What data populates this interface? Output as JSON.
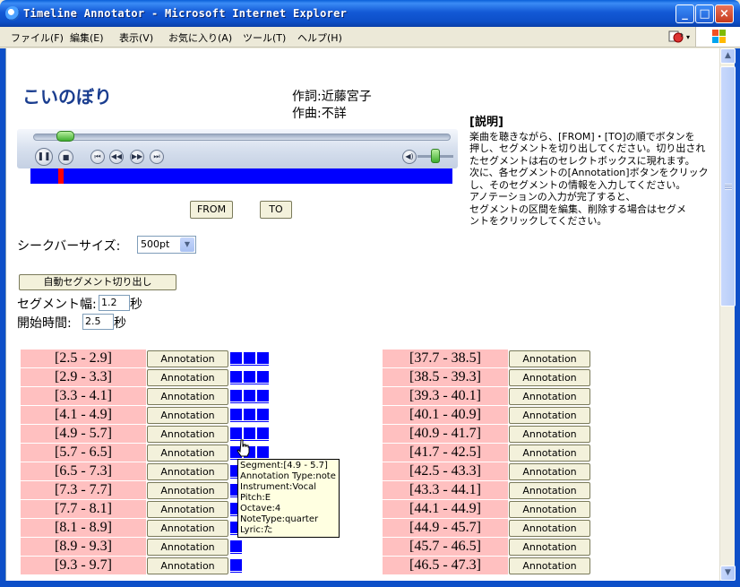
{
  "window": {
    "title": "Timeline Annotator - Microsoft Internet Explorer",
    "min_label": "_",
    "max_label": "□",
    "close_label": "×"
  },
  "menu": [
    "ファイル(F)",
    "編集(E)",
    "表示(V)",
    "お気に入り(A)",
    "ツール(T)",
    "ヘルプ(H)"
  ],
  "page": {
    "title": "こいのぼり",
    "lyricist": "作詞:近藤宮子",
    "composer": "作曲:不詳"
  },
  "player": {
    "seek_progress": 0.11,
    "marker_position_fraction": 0.065
  },
  "buttons": {
    "from": "FROM",
    "to": "TO",
    "auto_segment": "自動セグメント切り出し"
  },
  "explain": {
    "heading": "[説明]",
    "lines": [
      "楽曲を聴きながら、[FROM]・[TO]の順でボタンを",
      "押し、セグメントを切り出してください。切り出され",
      "たセグメントは右のセレクトボックスに現れます。",
      "次に、各セグメントの[Annotation]ボタンをクリック",
      "し、そのセグメントの情報を入力してください。",
      "アノテーションの入力が完了すると、",
      "セグメントの区間を編集、削除する場合はセグメ",
      "ントをクリックしてください。"
    ]
  },
  "controls": {
    "seekbar_size_label": "シークバーサイズ:",
    "seekbar_size_value": "500pt",
    "segment_width_label": "セグメント幅:",
    "segment_width_value": "1.2",
    "segment_width_unit": "秒",
    "start_time_label": "開始時間:",
    "start_time_value": "2.5",
    "start_time_unit": "秒"
  },
  "annotation_label": "Annotation",
  "segments_left": [
    {
      "range": "[2.5 - 2.9]",
      "squares": 3
    },
    {
      "range": "[2.9 - 3.3]",
      "squares": 3
    },
    {
      "range": "[3.3 - 4.1]",
      "squares": 3
    },
    {
      "range": "[4.1 - 4.9]",
      "squares": 3
    },
    {
      "range": "[4.9 - 5.7]",
      "squares": 3
    },
    {
      "range": "[5.7 - 6.5]",
      "squares": 3
    },
    {
      "range": "[6.5 - 7.3]",
      "squares": 1
    },
    {
      "range": "[7.3 - 7.7]",
      "squares": 1
    },
    {
      "range": "[7.7 - 8.1]",
      "squares": 1
    },
    {
      "range": "[8.1 - 8.9]",
      "squares": 1
    },
    {
      "range": "[8.9 - 9.3]",
      "squares": 1
    },
    {
      "range": "[9.3 - 9.7]",
      "squares": 1
    }
  ],
  "segments_right": [
    {
      "range": "[37.7 - 38.5]"
    },
    {
      "range": "[38.5 - 39.3]"
    },
    {
      "range": "[39.3 - 40.1]"
    },
    {
      "range": "[40.1 - 40.9]"
    },
    {
      "range": "[40.9 - 41.7]"
    },
    {
      "range": "[41.7 - 42.5]"
    },
    {
      "range": "[42.5 - 43.3]"
    },
    {
      "range": "[43.3 - 44.1]"
    },
    {
      "range": "[44.1 - 44.9]"
    },
    {
      "range": "[44.9 - 45.7]"
    },
    {
      "range": "[45.7 - 46.5]"
    },
    {
      "range": "[46.5 - 47.3]"
    }
  ],
  "tooltip": {
    "lines": [
      "Segment:[4.9 - 5.7]",
      "Annotation Type:note",
      "Instrument:Vocal",
      "Pitch:E",
      "Octave:4",
      "NoteType:quarter",
      "Lyric:た"
    ]
  },
  "colors": {
    "segment_bg": "#ffc0c0",
    "annotation_square": "#0000ff",
    "title_text": "#1a3d8f",
    "timeline": "#0000ff",
    "marker": "#ff0000"
  }
}
